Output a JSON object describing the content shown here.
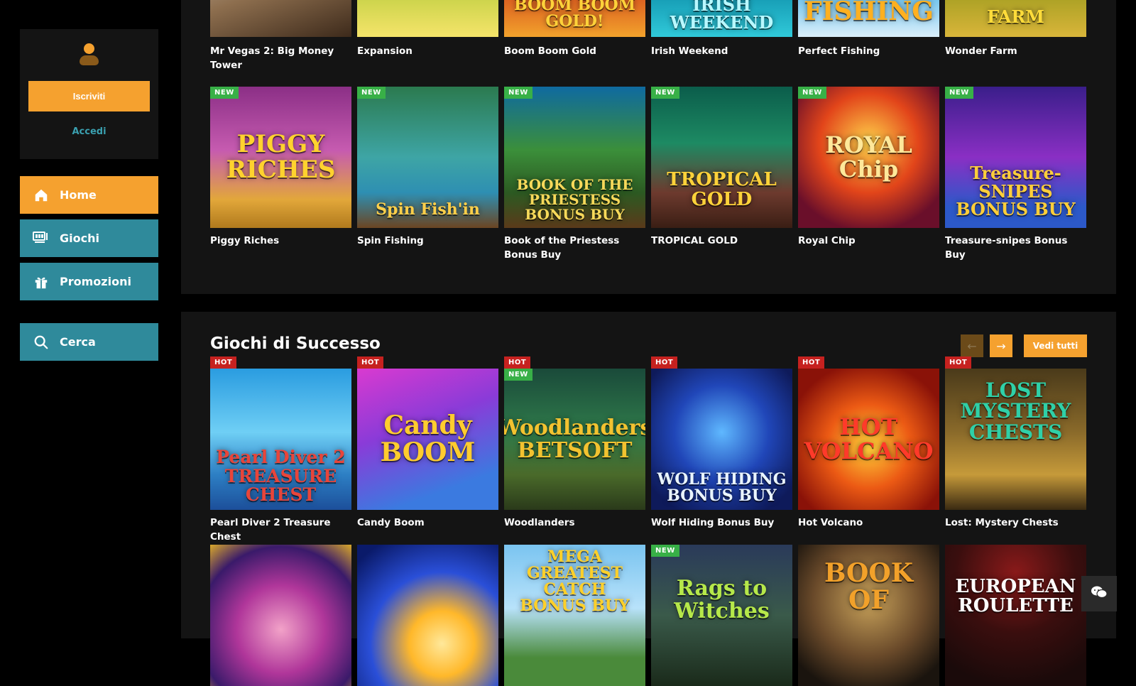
{
  "sidebar": {
    "signup_label": "Iscriviti",
    "login_label": "Accedi",
    "nav": [
      {
        "label": "Home",
        "icon": "home-icon"
      },
      {
        "label": "Giochi",
        "icon": "games-icon"
      },
      {
        "label": "Promozioni",
        "icon": "gift-icon"
      },
      {
        "label": "Cerca",
        "icon": "search-icon"
      }
    ]
  },
  "colors": {
    "accent": "#f5a12f",
    "teal": "#2f8a9b",
    "panel": "#141414",
    "badge_new": "#38b047",
    "badge_hot": "#c6211f"
  },
  "top_row": [
    {
      "name": "Mr Vegas 2: Big Money Tower"
    },
    {
      "name": "Expansion"
    },
    {
      "name": "Boom Boom Gold",
      "art": "BOOM BOOM GOLD!"
    },
    {
      "name": "Irish Weekend",
      "art": "IRISH WEEKEND"
    },
    {
      "name": "Perfect Fishing",
      "art": "FISHING"
    },
    {
      "name": "Wonder Farm",
      "art": "FARM"
    }
  ],
  "new_row": [
    {
      "name": "Piggy Riches",
      "badge": "NEW",
      "art": "PIGGY RICHES"
    },
    {
      "name": "Spin Fishing",
      "badge": "NEW",
      "art": "Spin Fish'in"
    },
    {
      "name": "Book of the Priestess Bonus Buy",
      "badge": "NEW",
      "art": "BOOK OF THE PRIESTESS BONUS BUY"
    },
    {
      "name": "TROPICAL GOLD",
      "badge": "NEW",
      "art": "TROPICAL GOLD"
    },
    {
      "name": "Royal Chip",
      "badge": "NEW",
      "art": "ROYAL Chip"
    },
    {
      "name": "Treasure-snipes Bonus Buy",
      "badge": "NEW",
      "art": "Treasure-SNIPES BONUS BUY"
    }
  ],
  "section": {
    "title": "Giochi di Successo",
    "prev_icon": "arrow-left-icon",
    "next_icon": "arrow-right-icon",
    "see_all_label": "Vedi tutti"
  },
  "hot_row": [
    {
      "name": "Pearl Diver 2 Treasure Chest",
      "badge": "HOT",
      "art": "Pearl Diver 2 TREASURE CHEST"
    },
    {
      "name": "Candy Boom",
      "badge": "HOT",
      "art": "Candy BOOM"
    },
    {
      "name": "Woodlanders",
      "badge": "HOT",
      "badge_top": "NEW",
      "art": "Woodlanders BETSOFT"
    },
    {
      "name": "Wolf Hiding Bonus Buy",
      "badge": "HOT",
      "art": "WOLF HIDING BONUS BUY"
    },
    {
      "name": "Hot Volcano",
      "badge": "HOT",
      "art": "HOT VOLCANO"
    },
    {
      "name": "Lost: Mystery Chests",
      "badge": "HOT",
      "art": "LOST MYSTERY CHESTS"
    }
  ],
  "bottom_row": [
    {
      "art": ""
    },
    {
      "art": ""
    },
    {
      "art": "MEGA GREATEST CATCH BONUS BUY"
    },
    {
      "art": "Rags to Witches",
      "badge": "NEW"
    },
    {
      "art": "BOOK OF"
    },
    {
      "art": "EUROPEAN ROULETTE"
    }
  ],
  "chat": {
    "icon": "chat-icon"
  }
}
